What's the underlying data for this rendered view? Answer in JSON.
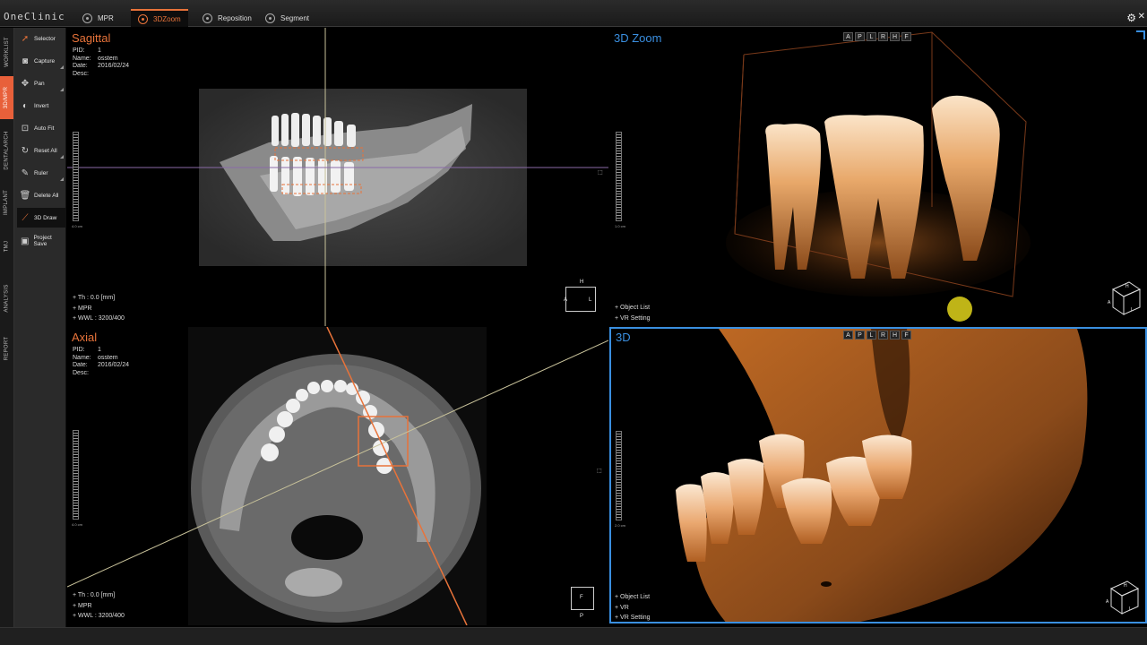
{
  "app": {
    "logo": "OneClinic"
  },
  "tabs": [
    {
      "label": "MPR",
      "icon": "mpr-icon"
    },
    {
      "label": "3DZoom",
      "icon": "3dzoom-icon"
    },
    {
      "label": "Reposition",
      "icon": "reposition-icon"
    },
    {
      "label": "Segment",
      "icon": "segment-icon"
    }
  ],
  "active_tab": "3DZoom",
  "vertical_tabs": [
    "WORKLIST",
    "3D/MPR",
    "DENTALARCH",
    "IMPLANT",
    "TMJ",
    "ANALYSIS",
    "REPORT"
  ],
  "active_vertical_tab": "3D/MPR",
  "tools": [
    {
      "label": "Selector",
      "icon": "cursor-icon"
    },
    {
      "label": "Capture",
      "icon": "camera-icon"
    },
    {
      "label": "Pan",
      "icon": "pan-icon"
    },
    {
      "label": "Invert",
      "icon": "invert-icon"
    },
    {
      "label": "Auto Fit",
      "icon": "autofit-icon"
    },
    {
      "label": "Reset All",
      "icon": "reset-icon"
    },
    {
      "label": "Ruler",
      "icon": "ruler-icon"
    },
    {
      "label": "Delete All",
      "icon": "trash-icon"
    },
    {
      "label": "3D Draw",
      "icon": "draw-icon"
    },
    {
      "label": "Project Save",
      "icon": "save-icon"
    }
  ],
  "active_tool": "3D Draw",
  "patient": {
    "pid_label": "PID:",
    "pid": "1",
    "name_label": "Name:",
    "name": "osstem",
    "date_label": "Date:",
    "date": "2016/02/24",
    "desc_label": "Desc:",
    "desc": ""
  },
  "viewports": {
    "sagittal": {
      "title": "Sagittal",
      "footer": [
        "+ Th : 0.0 [mm]",
        "+ MPR",
        "+ WWL : 3200/400"
      ],
      "scale_label": "4.0 cm",
      "orient": {
        "top": "H",
        "left": "A",
        "right": "L"
      }
    },
    "axial": {
      "title": "Axial",
      "footer": [
        "+ Th : 0.0 [mm]",
        "+ MPR",
        "+ WWL : 3200/400"
      ],
      "scale_label": "4.0 cm",
      "orient": {
        "center": "F",
        "left": "",
        "right": "L",
        "bottom": "P"
      }
    },
    "zoom3d": {
      "title": "3D Zoom",
      "orient_buttons": [
        "A",
        "P",
        "L",
        "R",
        "H",
        "F"
      ],
      "footer": [
        "+ Object List",
        "+ VR Setting"
      ],
      "scale_label": "1.0 cm",
      "cube_labels": {
        "top": "H",
        "left": "A",
        "right": "L"
      }
    },
    "vr3d": {
      "title": "3D",
      "orient_buttons": [
        "A",
        "P",
        "L",
        "R",
        "H",
        "F"
      ],
      "footer": [
        "+ Object List",
        "+ VR",
        "+ VR Setting"
      ],
      "scale_label": "2.0 cm",
      "cube_labels": {
        "top": "H",
        "left": "A",
        "right": "L"
      }
    }
  },
  "colors": {
    "accent": "#e8733a",
    "blue": "#3a8fe0",
    "bone": "#d98a48"
  }
}
